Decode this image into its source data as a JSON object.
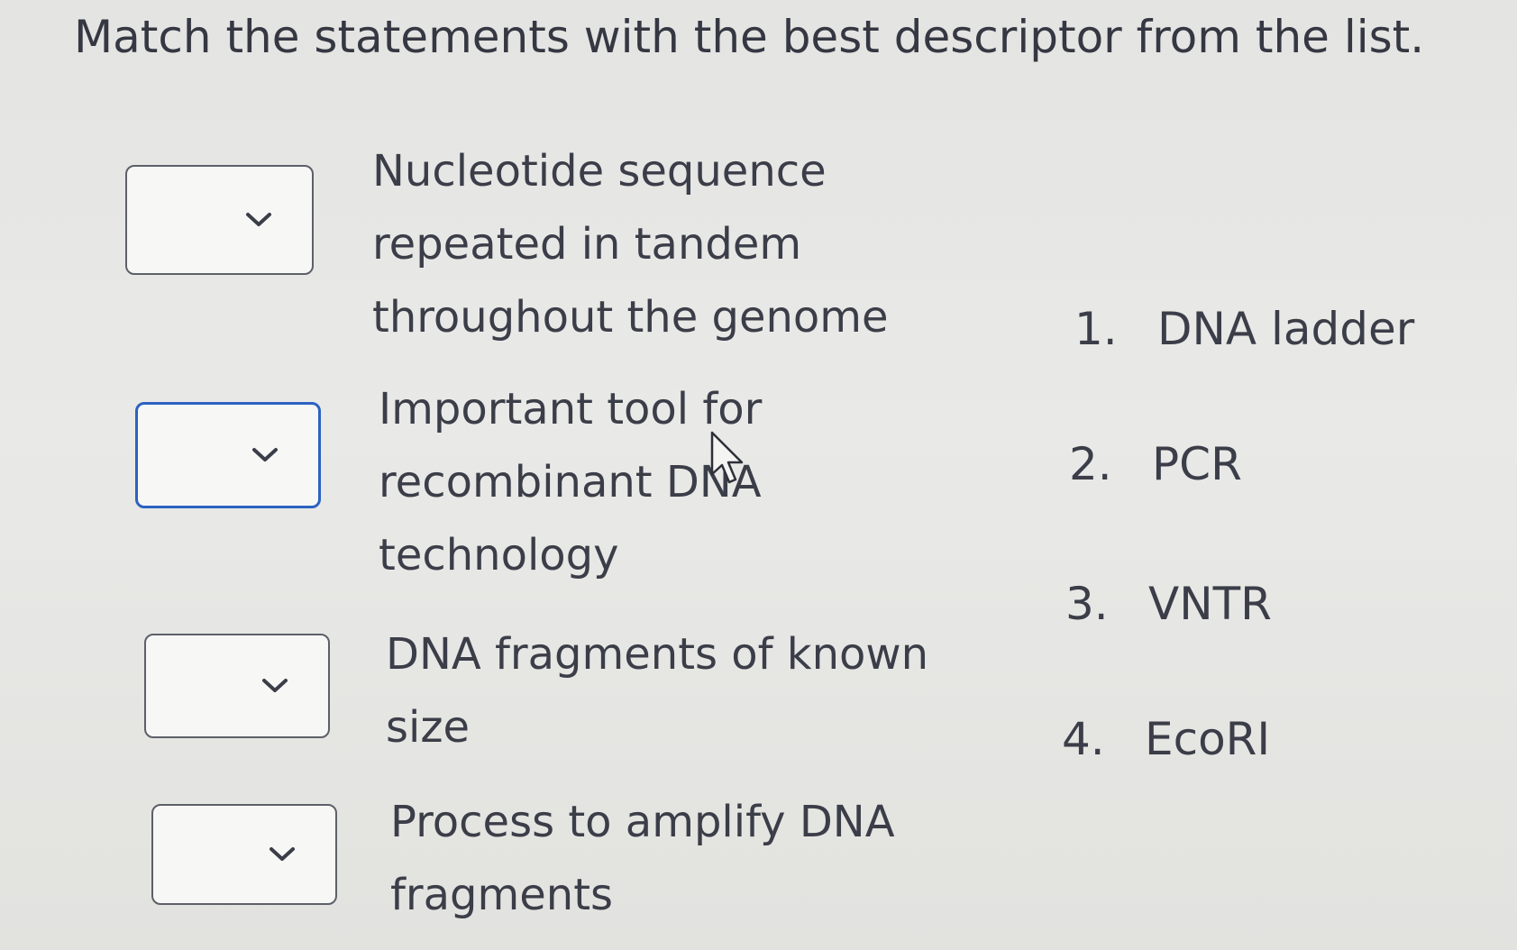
{
  "question": {
    "instructions": "Match the statements with the best descriptor from the list."
  },
  "statements": [
    {
      "text": "Nucleotide sequence\nrepeated in tandem\nthroughout the genome",
      "selected": ""
    },
    {
      "text": "Important tool for\nrecombinant DNA\ntechnology",
      "selected": ""
    },
    {
      "text": "DNA fragments of known\nsize",
      "selected": ""
    },
    {
      "text": "Process to amplify DNA\nfragments",
      "selected": ""
    }
  ],
  "options": [
    {
      "number": "1.",
      "label": "DNA ladder"
    },
    {
      "number": "2.",
      "label": "PCR"
    },
    {
      "number": "3.",
      "label": "VNTR"
    },
    {
      "number": "4.",
      "label": "EcoRI"
    }
  ],
  "icons": {
    "dropdown": "chevron-down-icon",
    "cursor": "mouse-pointer-icon"
  },
  "colors": {
    "focus_border": "#2c62c2",
    "text": "#3b3e48"
  }
}
